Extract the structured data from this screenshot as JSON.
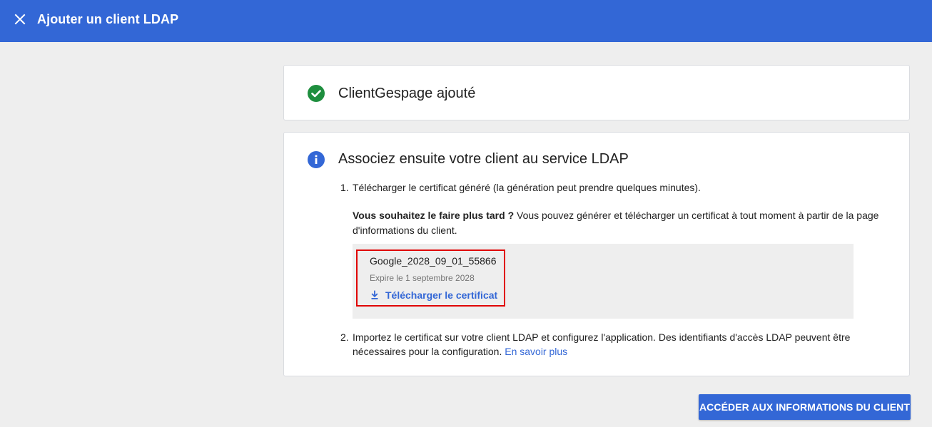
{
  "header": {
    "title": "Ajouter un client LDAP",
    "close_icon": "close-icon",
    "background": "#3367d6"
  },
  "success_card": {
    "icon": "check-circle-icon",
    "icon_color": "#1e8e3e",
    "text": "ClientGespage ajouté"
  },
  "info_card": {
    "icon": "info-icon",
    "icon_color": "#3367d6",
    "title": "Associez ensuite votre client au service LDAP",
    "step1": {
      "number": "1.",
      "text": "Télécharger le certificat généré (la génération peut prendre quelques minutes)."
    },
    "later": {
      "bold": "Vous souhaitez le faire plus tard ?",
      "text": " Vous pouvez générer et télécharger un certificat à tout moment à partir de la page d'informations du client."
    },
    "certificate": {
      "name": "Google_2028_09_01_55866",
      "expiry": "Expire le 1 septembre 2028",
      "download_icon": "download-icon",
      "download_label": "Télécharger le certificat"
    },
    "step2": {
      "number": "2.",
      "line1": "Importez le certificat sur votre client LDAP et configurez l'application. Des identifiants d'accès LDAP peuvent être",
      "line2": "nécessaires pour la configuration.",
      "link": "En savoir plus"
    }
  },
  "footer": {
    "action_label": "ACCÉDER AUX INFORMATIONS DU CLIENT"
  }
}
